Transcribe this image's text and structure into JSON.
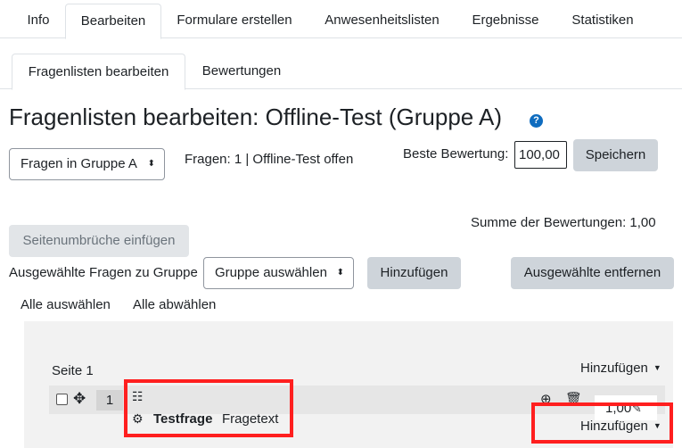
{
  "tabs": [
    "Info",
    "Bearbeiten",
    "Formulare erstellen",
    "Anwesenheitslisten",
    "Ergebnisse",
    "Statistiken"
  ],
  "subtabs": [
    "Fragenlisten bearbeiten",
    "Bewertungen"
  ],
  "title": "Fragenlisten bearbeiten: Offline-Test (Gruppe A)",
  "help_icon_glyph": "?",
  "group_select": {
    "value": "Fragen in Gruppe A",
    "caret": "⬍"
  },
  "info_text": "Fragen: 1 | Offline-Test offen",
  "max_grade": {
    "label": "Beste Bewertung:",
    "value": "100,00",
    "save": "Speichern"
  },
  "sum_grades": "Summe der Bewertungen: 1,00",
  "repaginate": "Seitenumbrüche einfügen",
  "bulk": {
    "label": "Ausgewählte Fragen zu Gruppe",
    "select_value": "Gruppe auswählen",
    "add": "Hinzufügen",
    "remove": "Ausgewählte entfernen"
  },
  "select_all": "Alle auswählen",
  "deselect_all": "Alle abwählen",
  "page_label": "Seite 1",
  "add_menu": "Hinzufügen",
  "question": {
    "slot": "1",
    "name": "Testfrage",
    "text": "Fragetext",
    "mark": "1,00"
  },
  "icons": {
    "move": "✥",
    "qtype": "☷",
    "gear": "⚙",
    "preview": "⊕",
    "delete": "🗑",
    "edit": "✎",
    "caret": "▼"
  },
  "highlight_color": "#ff1f1f"
}
